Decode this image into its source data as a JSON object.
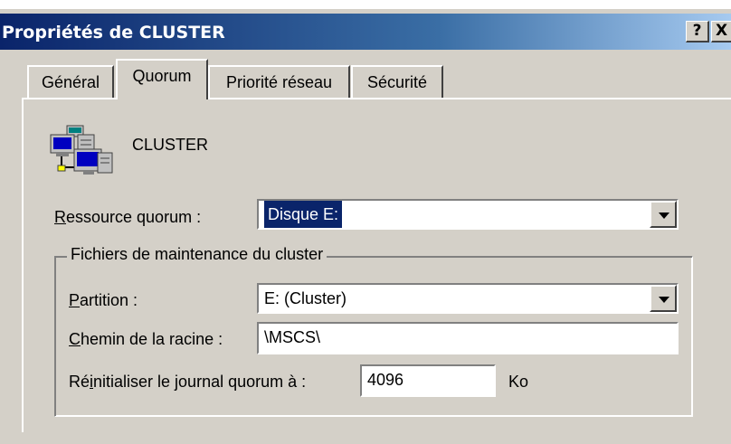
{
  "window": {
    "title": "Propriétés de CLUSTER",
    "help_label": "?",
    "close_label": "X"
  },
  "tabs": [
    {
      "label": "Général",
      "active": false
    },
    {
      "label": "Quorum",
      "active": true
    },
    {
      "label": "Priorité réseau",
      "active": false
    },
    {
      "label": "Sécurité",
      "active": false
    }
  ],
  "header": {
    "icon": "cluster-computers-icon",
    "name": "CLUSTER"
  },
  "quorum": {
    "resource_label_accel": "R",
    "resource_label_rest": "essource quorum :",
    "resource_value": "Disque E:"
  },
  "maintenance": {
    "group_label": "Fichiers de maintenance du cluster",
    "partition_accel": "P",
    "partition_rest": "artition :",
    "partition_value": "E: (Cluster)",
    "root_accel": "C",
    "root_rest": "hemin de la racine :",
    "root_value": "\\MSCS\\",
    "reset_pre": "Ré",
    "reset_accel": "i",
    "reset_post": "nitialiser le journal quorum à :",
    "reset_value": "4096",
    "reset_unit": "Ko"
  },
  "colors": {
    "titlebar_start": "#0a246a",
    "titlebar_end": "#a6caf0",
    "face": "#d4d0c8",
    "selection": "#0a246a"
  }
}
